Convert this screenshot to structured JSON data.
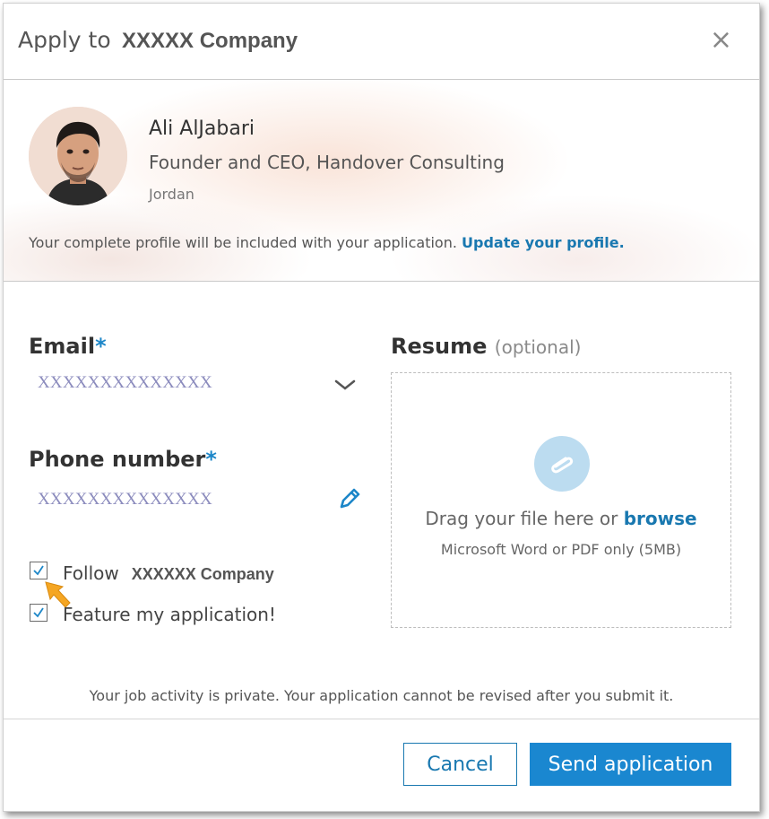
{
  "header": {
    "title_prefix": "Apply to",
    "company": "XXXXX Company",
    "close_icon": "×"
  },
  "profile": {
    "name": "Ali AlJabari",
    "headline": "Founder and CEO, Handover Consulting",
    "location": "Jordan",
    "note": "Your complete profile will be included with your application.",
    "update_link": "Update your profile."
  },
  "form": {
    "email_label": "Email",
    "email_value": "XXXXXXXXXXXXXX",
    "phone_label": "Phone number",
    "phone_value": "XXXXXXXXXXXXXX",
    "required_mark": "*",
    "follow_label": "Follow",
    "follow_company": "XXXXXX Company",
    "follow_checked": true,
    "feature_label": "Feature my application!",
    "feature_checked": true
  },
  "resume": {
    "label": "Resume",
    "optional": "(optional)",
    "drag_text": "Drag your file here or",
    "browse_link": "browse",
    "hint": "Microsoft Word or PDF only (5MB)",
    "icon": "paperclip-icon"
  },
  "footer": {
    "privacy_note": "Your job activity is private. Your application cannot be revised after you submit it.",
    "cancel_label": "Cancel",
    "send_label": "Send application"
  },
  "colors": {
    "accent": "#1978b0",
    "primary_button": "#1a87d0",
    "pointer": "#f5a623"
  }
}
